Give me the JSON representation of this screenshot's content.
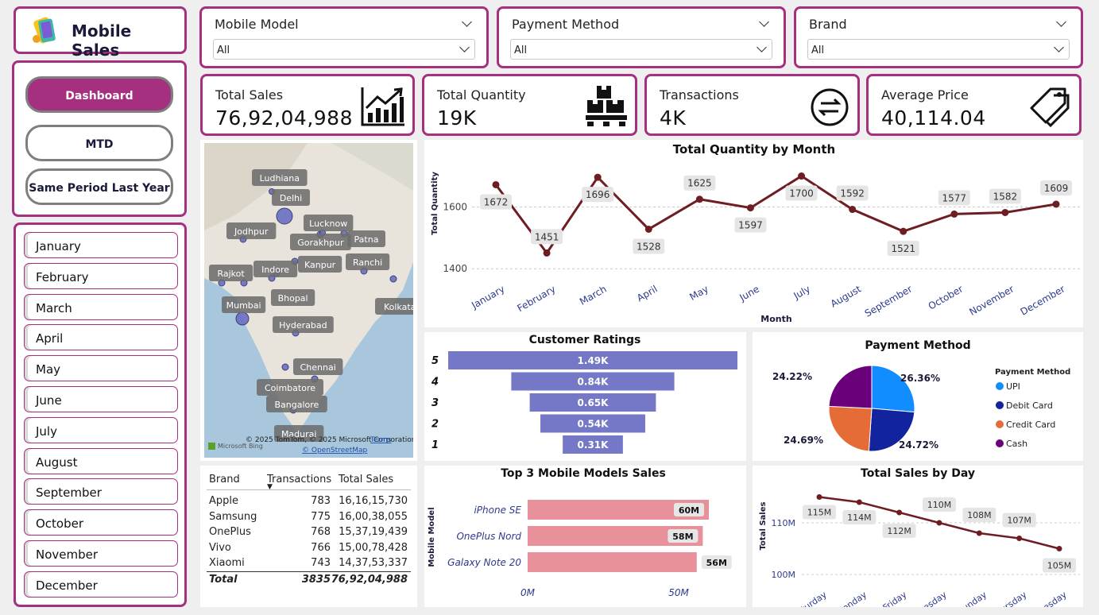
{
  "app": {
    "title": "Mobile Sales"
  },
  "filters": [
    {
      "label": "Mobile Model",
      "value": "All"
    },
    {
      "label": "Payment Method",
      "value": "All"
    },
    {
      "label": "Brand",
      "value": "All"
    }
  ],
  "nav": {
    "dashboard": "Dashboard",
    "mtd": "MTD",
    "splY": "Same Period Last Year"
  },
  "months": [
    "January",
    "February",
    "March",
    "April",
    "May",
    "June",
    "July",
    "August",
    "September",
    "October",
    "November",
    "December"
  ],
  "kpis": [
    {
      "label": "Total Sales",
      "value": "76,92,04,988",
      "icon": "chart-growth-icon"
    },
    {
      "label": "Total Quantity",
      "value": "19K",
      "icon": "boxes-icon"
    },
    {
      "label": "Transactions",
      "value": "4K",
      "icon": "exchange-icon"
    },
    {
      "label": "Average Price",
      "value": "40,114.04",
      "icon": "price-tag-icon"
    }
  ],
  "map": {
    "cities": [
      "Ludhiana",
      "Delhi",
      "Jodhpur",
      "Lucknow",
      "Patna",
      "Gorakhpur",
      "Indore",
      "Kanpur",
      "Ranchi",
      "Rajkot",
      "Bhopal",
      "Mumbai",
      "Kolkata",
      "Hyderabad",
      "Chennai",
      "Coimbatore",
      "Bangalore",
      "Madurai"
    ],
    "attribution": "© 2025 TomTom, © 2025 Microsoft Corporation,",
    "osm": "© OpenStreetMap",
    "terms": "Terms",
    "logo": "Microsoft Bing"
  },
  "brand_table": {
    "headers": [
      "Brand",
      "Transactions",
      "Total Sales"
    ],
    "rows": [
      [
        "Apple",
        "783",
        "16,16,15,730"
      ],
      [
        "Samsung",
        "775",
        "16,00,38,055"
      ],
      [
        "OnePlus",
        "768",
        "15,37,19,439"
      ],
      [
        "Vivo",
        "766",
        "15,00,78,428"
      ],
      [
        "Xiaomi",
        "743",
        "14,37,53,337"
      ]
    ],
    "total": [
      "Total",
      "3835",
      "76,92,04,988"
    ]
  },
  "chart_data": [
    {
      "type": "line",
      "title": "Total Quantity by Month",
      "xlabel": "Month",
      "ylabel": "Total Quantity",
      "categories": [
        "January",
        "February",
        "March",
        "April",
        "May",
        "June",
        "July",
        "August",
        "September",
        "October",
        "November",
        "December"
      ],
      "values": [
        1672,
        1451,
        1696,
        1528,
        1625,
        1597,
        1700,
        1592,
        1521,
        1577,
        1582,
        1609
      ],
      "labels": [
        "1672",
        "1451",
        "1696",
        "1528",
        "1625",
        "1597",
        "1700",
        "1592",
        "1521",
        "1577",
        "1582",
        "1609"
      ],
      "ticks": [
        "1400",
        "1600"
      ],
      "ylim": [
        1380,
        1740
      ],
      "color": "#6e1e23"
    },
    {
      "type": "bar",
      "title": "Customer Ratings",
      "categories": [
        "5",
        "4",
        "3",
        "2",
        "1"
      ],
      "values": [
        1490,
        840,
        650,
        540,
        310
      ],
      "labels": [
        "1.49K",
        "0.84K",
        "0.65K",
        "0.54K",
        "0.31K"
      ],
      "color": "#7478c6"
    },
    {
      "type": "pie",
      "title": "Payment Method",
      "legend_title": "Payment Method",
      "categories": [
        "UPI",
        "Debit Card",
        "Credit Card",
        "Cash"
      ],
      "values": [
        26.36,
        24.72,
        24.69,
        24.22
      ],
      "labels": [
        "26.36%",
        "24.72%",
        "24.69%",
        "24.22%"
      ],
      "colors": [
        "#118dff",
        "#12239e",
        "#e66c37",
        "#6b007b"
      ]
    },
    {
      "type": "bar",
      "title": "Top 3 Mobile Models Sales",
      "ylabel": "Mobile Model",
      "categories": [
        "iPhone SE",
        "OnePlus Nord",
        "Galaxy Note 20"
      ],
      "values": [
        60,
        58,
        56
      ],
      "labels": [
        "60M",
        "58M",
        "56M"
      ],
      "ticks": [
        "0M",
        "50M"
      ],
      "xlim": [
        0,
        62
      ],
      "color": "#e8919b"
    },
    {
      "type": "line",
      "title": "Total Sales by Day",
      "ylabel": "Total Sales",
      "categories": [
        "Saturday",
        "Monday",
        "Friday",
        "Tuesday",
        "Sunday",
        "Thursday",
        "Wednesday"
      ],
      "values": [
        115,
        114,
        112,
        110,
        108,
        107,
        105
      ],
      "labels": [
        "115M",
        "114M",
        "112M",
        "110M",
        "108M",
        "107M",
        "105M"
      ],
      "ticks": [
        "100M",
        "110M"
      ],
      "ylim": [
        98,
        118
      ],
      "color": "#6e1e23"
    }
  ]
}
